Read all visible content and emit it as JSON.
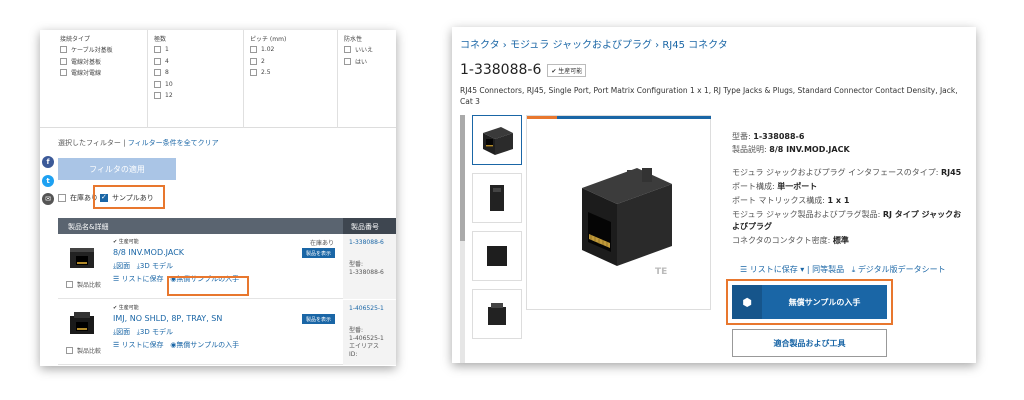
{
  "left": {
    "filters": [
      {
        "title": "接続タイプ",
        "options": [
          "ケーブル対基板",
          "電線対基板",
          "電線対電線"
        ]
      },
      {
        "title": "極数",
        "options": [
          "1",
          "4",
          "8",
          "10",
          "12"
        ]
      },
      {
        "title": "ピッチ (mm)",
        "options": [
          "1.02",
          "2",
          "2.5"
        ]
      },
      {
        "title": "防水性",
        "options": [
          "いいえ",
          "はい"
        ]
      }
    ],
    "selected_filter_label": "選択したフィルター",
    "selected_filter_sep": "|",
    "clear_all_link": "フィルター条件を全てクリア",
    "apply_button": "フィルタの適用",
    "social": {
      "facebook": "f",
      "twitter": "t",
      "mail": "✉"
    },
    "in_stock_label": "在庫あり",
    "sample_label": "サンプルあり",
    "table": {
      "col_name": "製品名&詳細",
      "col_pn": "製品番号",
      "rows": [
        {
          "status": "✔ 生産可能",
          "name": "8/8 INV.MOD.JACK",
          "drawing": "図面",
          "model": "3D モデル",
          "save": "リストに保存",
          "sample": "無償サンプルの入手",
          "compare": "製品比較",
          "stock": "在庫あり",
          "show": "製品を表示",
          "pn": "1-338088-6",
          "type_label": "型番:",
          "type_value": "1-338088-6"
        },
        {
          "status": "✔ 生産可能",
          "name": "IMJ, NO SHLD, 8P, TRAY, SN",
          "drawing": "図面",
          "model": "3D モデル",
          "save": "リストに保存",
          "sample": "無償サンプルの入手",
          "compare": "製品比較",
          "show": "製品を表示",
          "pn": "1-406525-1",
          "type_label": "型番:",
          "type_value": "1-406525-1",
          "extra": "エイリアス",
          "extra2": "ID:"
        }
      ]
    }
  },
  "right": {
    "breadcrumb": [
      "コネクタ",
      "モジュラ ジャックおよびプラグ",
      "RJ45 コネクタ"
    ],
    "breadcrumb_sep": "›",
    "title": "1-338088-6",
    "badge": "✔ 生産可能",
    "description": "RJ45 Connectors, RJ45, Single Port, Port Matrix Configuration 1 x 1, RJ Type Jacks & Plugs, Standard Connector Contact Density, Jack, Cat 3",
    "specs": {
      "model_label": "型番:",
      "model_value": "1-338088-6",
      "desc_label": "製品説明:",
      "desc_value": "8/8 INV.MOD.JACK",
      "s1_label": "モジュラ ジャックおよびプラグ インタフェースのタイプ:",
      "s1_value": "RJ45",
      "s2_label": "ポート構成:",
      "s2_value": "単一ポート",
      "s3_label": "ポート マトリックス構成:",
      "s3_value": "1 x 1",
      "s4_label": "モジュラ ジャック製品およびプラグ製品:",
      "s4_value_a": "RJ タイプ ジャックお",
      "s4_value_b": "よびプラグ",
      "s5_label": "コネクタのコンタクト密度:",
      "s5_value": "標準"
    },
    "actions": {
      "save": "リストに保存 ▾",
      "sep": "|",
      "same": "同等製品",
      "datasheet": "デジタル版データシート"
    },
    "sample_button": "無償サンプルの入手",
    "tools_button": "適合製品および工具",
    "watermark": "TE",
    "colors": {
      "accent_blue": "#1a66a6",
      "highlight_orange": "#e8772e"
    }
  }
}
